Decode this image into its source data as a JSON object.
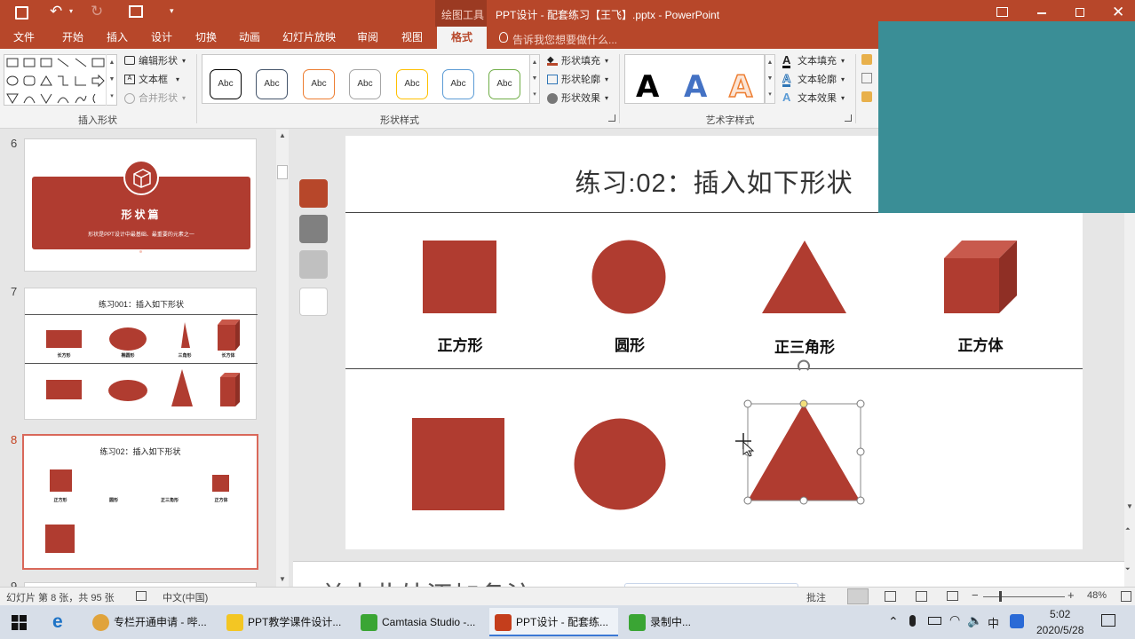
{
  "window": {
    "contextual_tab": "绘图工具",
    "title": "PPT设计 - 配套练习【王飞】.pptx - PowerPoint",
    "controls": [
      "minimize",
      "restore",
      "close"
    ]
  },
  "tabs": [
    {
      "label": "文件"
    },
    {
      "label": "开始"
    },
    {
      "label": "插入"
    },
    {
      "label": "设计"
    },
    {
      "label": "切换"
    },
    {
      "label": "动画"
    },
    {
      "label": "幻灯片放映"
    },
    {
      "label": "审阅"
    },
    {
      "label": "视图"
    },
    {
      "label": "格式",
      "active": true
    }
  ],
  "tell_me": "告诉我您想要做什么...",
  "ribbon": {
    "insert_shapes": {
      "label": "插入形状",
      "edit_shape": "编辑形状",
      "text_box": "文本框",
      "merge_shapes": "合并形状"
    },
    "shape_styles": {
      "label": "形状样式",
      "presets": [
        {
          "text": "Abc",
          "border": "#000000"
        },
        {
          "text": "Abc",
          "border": "#44546a"
        },
        {
          "text": "Abc",
          "border": "#ed7d31"
        },
        {
          "text": "Abc",
          "border": "#a5a5a5"
        },
        {
          "text": "Abc",
          "border": "#ffc000"
        },
        {
          "text": "Abc",
          "border": "#5b9bd5"
        },
        {
          "text": "Abc",
          "border": "#70ad47"
        }
      ],
      "fill": "形状填充",
      "outline": "形状轮廓",
      "effects": "形状效果"
    },
    "wordart": {
      "label": "艺术字样式",
      "samples": [
        {
          "text": "A",
          "color": "#000000"
        },
        {
          "text": "A",
          "color": "#4472c4"
        },
        {
          "text": "A",
          "color": "#ed7d31"
        }
      ],
      "fill": "文本填充",
      "outline": "文本轮廓",
      "effects": "文本效果"
    }
  },
  "thumbnails": [
    {
      "num": "6",
      "title": "形状篇",
      "subtitle": "形状是PPT设计中最基础、最重要的元素之一"
    },
    {
      "num": "7",
      "title": "练习001：插入如下形状",
      "labels": [
        "长方形",
        "椭圆形",
        "三角形",
        "长方体"
      ]
    },
    {
      "num": "8",
      "title": "练习02：插入如下形状",
      "labels": [
        "正方形",
        "圆形",
        "正三角形",
        "正方体"
      ],
      "selected": true
    },
    {
      "num": "9"
    }
  ],
  "swatches": [
    "#b7472a",
    "#808080",
    "#c0c0c0",
    "#ffffff"
  ],
  "slide": {
    "title": "练习:02：插入如下形状",
    "shape_color": "#b03c30",
    "labels": [
      "正方形",
      "圆形",
      "正三角形",
      "正方体"
    ]
  },
  "notes": "单击此处添加备注",
  "status": {
    "slide_info": "幻灯片 第 8 张，共 95 张",
    "language": "中文(中国)",
    "comments": "批注",
    "zoom": "48%"
  },
  "ime_toolbar": [
    "中",
    "°,",
    "☺",
    "✂",
    "⌨",
    "👤",
    "👕",
    "⚙"
  ],
  "taskbar": {
    "items": [
      {
        "label": "专栏开通申请 - 哔...",
        "color": "#e0a33b"
      },
      {
        "label": "PPT教学课件设计...",
        "color": "#f3c623"
      },
      {
        "label": "Camtasia Studio -...",
        "color": "#3aa534"
      },
      {
        "label": "PPT设计 - 配套练...",
        "color": "#c43e1c"
      },
      {
        "label": "录制中...",
        "color": "#3aa534"
      }
    ],
    "tray_text": "中",
    "time": "5:02",
    "date": "2020/5/28"
  }
}
